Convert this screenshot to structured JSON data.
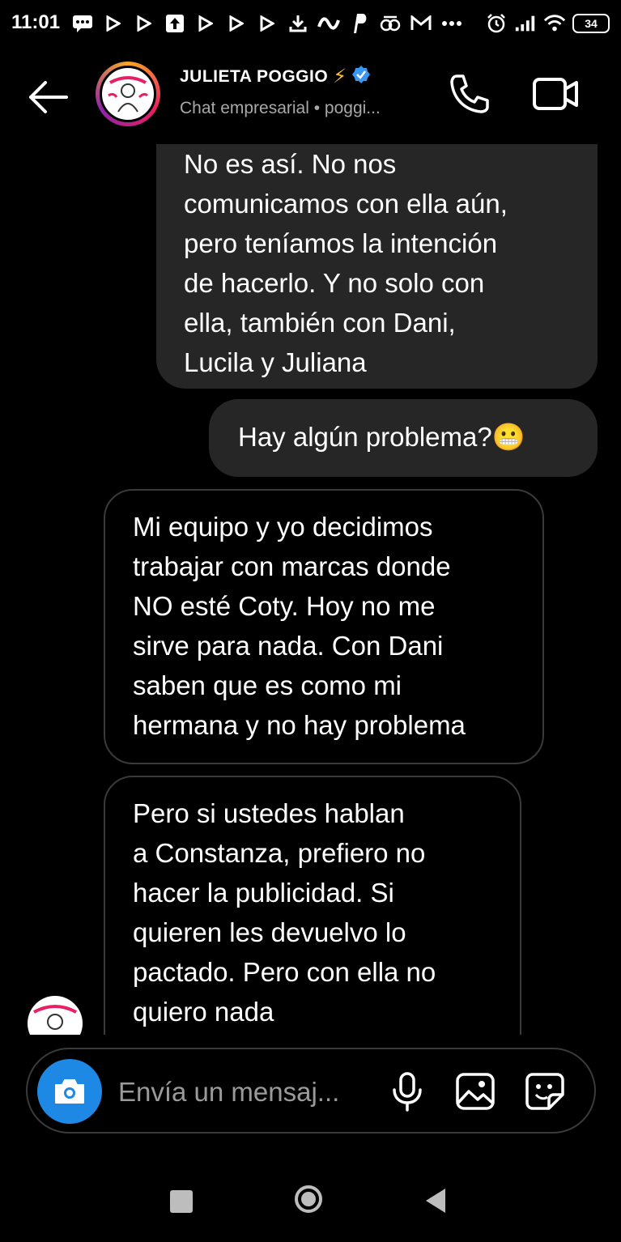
{
  "status_bar": {
    "time": "11:01",
    "battery": "34",
    "left_icons": [
      "message-icon",
      "play-icon",
      "play-icon",
      "upload-icon",
      "play-icon",
      "play-icon",
      "play-icon",
      "download-icon",
      "infinity-icon",
      "paypal-icon",
      "oo-icon",
      "gmail-icon",
      "more-dots-icon"
    ],
    "right_icons": [
      "alarm-icon",
      "signal-icon",
      "wifi-icon",
      "battery-icon"
    ]
  },
  "header": {
    "contact_name": "JULIETA POGGIO",
    "name_emoji": "⚡",
    "subtitle": "Chat empresarial • poggi...",
    "verified_color": "#3897f0",
    "avatar_ring_colors": [
      "#f9a825",
      "#e91e63",
      "#8e24aa"
    ]
  },
  "messages": [
    {
      "direction": "sent",
      "lines": [
        "No es así. No nos",
        "comunicamos con ella aún,",
        "pero teníamos la intención",
        "de hacerlo. Y no solo con",
        "ella, también con Dani,",
        "Lucila y Juliana"
      ]
    },
    {
      "direction": "sent",
      "lines": [
        "Hay algún problema?😬"
      ]
    },
    {
      "direction": "received",
      "lines": [
        "Mi equipo y yo decidimos",
        "trabajar con marcas donde",
        "NO esté Coty. Hoy no me",
        "sirve para nada. Con Dani",
        "saben que es como mi",
        "hermana y no hay problema"
      ]
    },
    {
      "direction": "received",
      "lines": [
        "Pero si ustedes hablan",
        "a Constanza, prefiero no",
        "hacer la publicidad. Si",
        "quieren les devuelvo lo",
        "pactado. Pero con ella no",
        "quiero nada"
      ]
    }
  ],
  "composer": {
    "placeholder": "Envía un mensaj...",
    "camera_color": "#1e88e5"
  },
  "colors": {
    "background": "#000000",
    "sent_bubble": "#262626",
    "received_border": "#3a3a3a"
  }
}
